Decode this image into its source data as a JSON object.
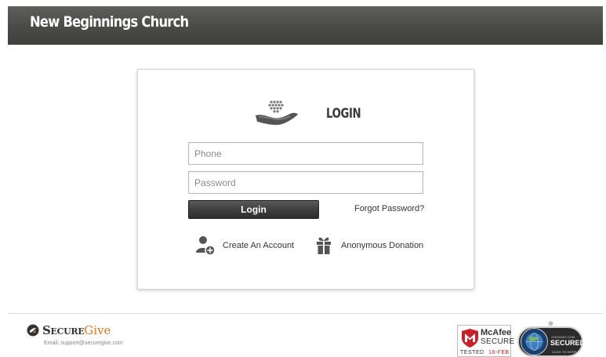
{
  "header": {
    "title": "New Beginnings Church"
  },
  "login": {
    "heading": "LOGIN",
    "phone_placeholder": "Phone",
    "phone_value": "",
    "password_placeholder": "Password",
    "password_value": "",
    "login_label": "Login",
    "forgot_label": "Forgot Password?",
    "create_account_label": "Create An Account",
    "anonymous_donation_label": "Anonymous Donation"
  },
  "footer": {
    "brand_secure": "Secure",
    "brand_give": "Give",
    "email_text": "Email: support@securegive.com",
    "mcafee_brand": "McAfee",
    "mcafee_secure": "SECURE",
    "mcafee_tested": "TESTED",
    "mcafee_date": "18-FEB",
    "godaddy_small": "GODADDY.COM",
    "godaddy_secured": "SECURED",
    "godaddy_verify": "CLICK TO VERIFY"
  },
  "colors": {
    "header_bg": "#4a4a48",
    "button_bg": "#3c3c3c",
    "give_orange": "#e0781e",
    "mcafee_red": "#c8202a"
  },
  "icons": {
    "logo": "hand-coins-icon",
    "create_account": "user-add-icon",
    "anonymous_donation": "gift-icon",
    "securegive": "securegive-logo-icon",
    "mcafee": "mcafee-shield-icon",
    "godaddy": "globe-icon"
  }
}
